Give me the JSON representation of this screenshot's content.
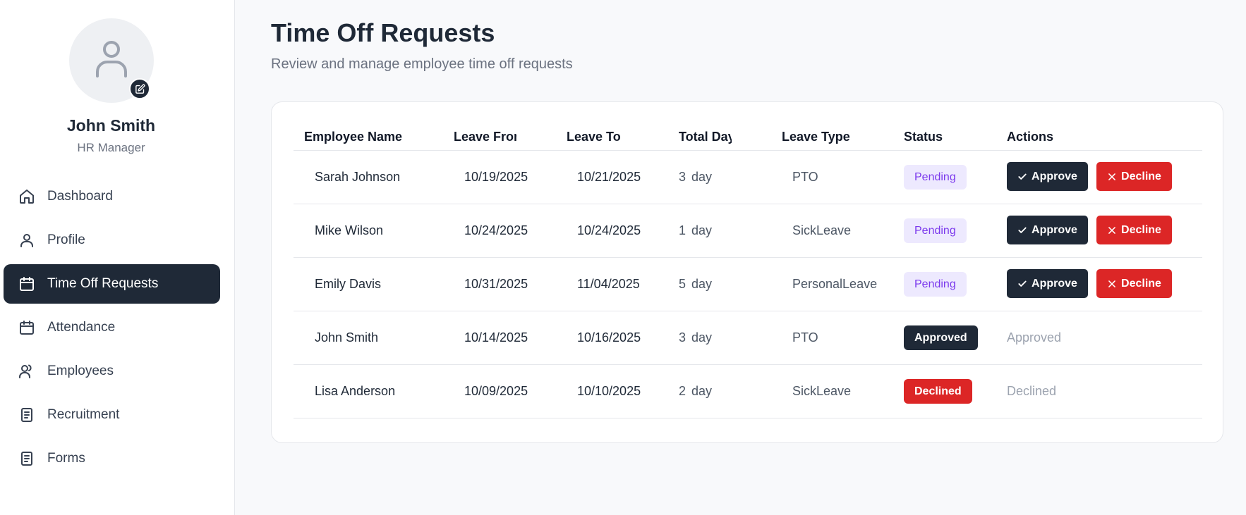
{
  "profile": {
    "name": "John Smith",
    "role": "HR Manager",
    "avatar_icon": "user-icon",
    "edit_icon": "edit-icon"
  },
  "nav": [
    {
      "label": "Dashboard",
      "icon": "home-icon",
      "active": false
    },
    {
      "label": "Profile",
      "icon": "user-icon",
      "active": false
    },
    {
      "label": "Time Off Requests",
      "icon": "calendar-icon",
      "active": true
    },
    {
      "label": "Attendance",
      "icon": "calendar-icon",
      "active": false
    },
    {
      "label": "Employees",
      "icon": "users-icon",
      "active": false
    },
    {
      "label": "Recruitment",
      "icon": "document-icon",
      "active": false
    },
    {
      "label": "Forms",
      "icon": "document-icon",
      "active": false
    }
  ],
  "page": {
    "title": "Time Off Requests",
    "subtitle": "Review and manage employee time off requests"
  },
  "table": {
    "headers": [
      "Employee Name",
      "Leave From",
      "Leave To",
      "Total Days",
      "Leave Type",
      "Status",
      "Actions"
    ],
    "rows": [
      {
        "name": "Sarah Johnson",
        "from": "10/19/2025",
        "to": "10/21/2025",
        "days": "3",
        "unit": "day",
        "type": "PTO",
        "status": "Pending",
        "status_kind": "pending",
        "approve_label": "Approve",
        "decline_label": "Decline",
        "action_text": ""
      },
      {
        "name": "Mike Wilson",
        "from": "10/24/2025",
        "to": "10/24/2025",
        "days": "1",
        "unit": "day",
        "type": "SickLeave",
        "status": "Pending",
        "status_kind": "pending",
        "approve_label": "Approve",
        "decline_label": "Decline",
        "action_text": ""
      },
      {
        "name": "Emily Davis",
        "from": "10/31/2025",
        "to": "11/04/2025",
        "days": "5",
        "unit": "day",
        "type": "PersonalLeave",
        "status": "Pending",
        "status_kind": "pending",
        "approve_label": "Approve",
        "decline_label": "Decline",
        "action_text": ""
      },
      {
        "name": "John Smith",
        "from": "10/14/2025",
        "to": "10/16/2025",
        "days": "3",
        "unit": "day",
        "type": "PTO",
        "status": "Approved",
        "status_kind": "approved",
        "approve_label": "",
        "decline_label": "",
        "action_text": "Approved"
      },
      {
        "name": "Lisa Anderson",
        "from": "10/09/2025",
        "to": "10/10/2025",
        "days": "2",
        "unit": "day",
        "type": "SickLeave",
        "status": "Declined",
        "status_kind": "declined",
        "approve_label": "",
        "decline_label": "",
        "action_text": "Declined"
      }
    ]
  },
  "colors": {
    "primary": "#1f2937",
    "danger": "#dc2626",
    "pending_bg": "#ede9fe",
    "pending_text": "#7c3aed"
  }
}
